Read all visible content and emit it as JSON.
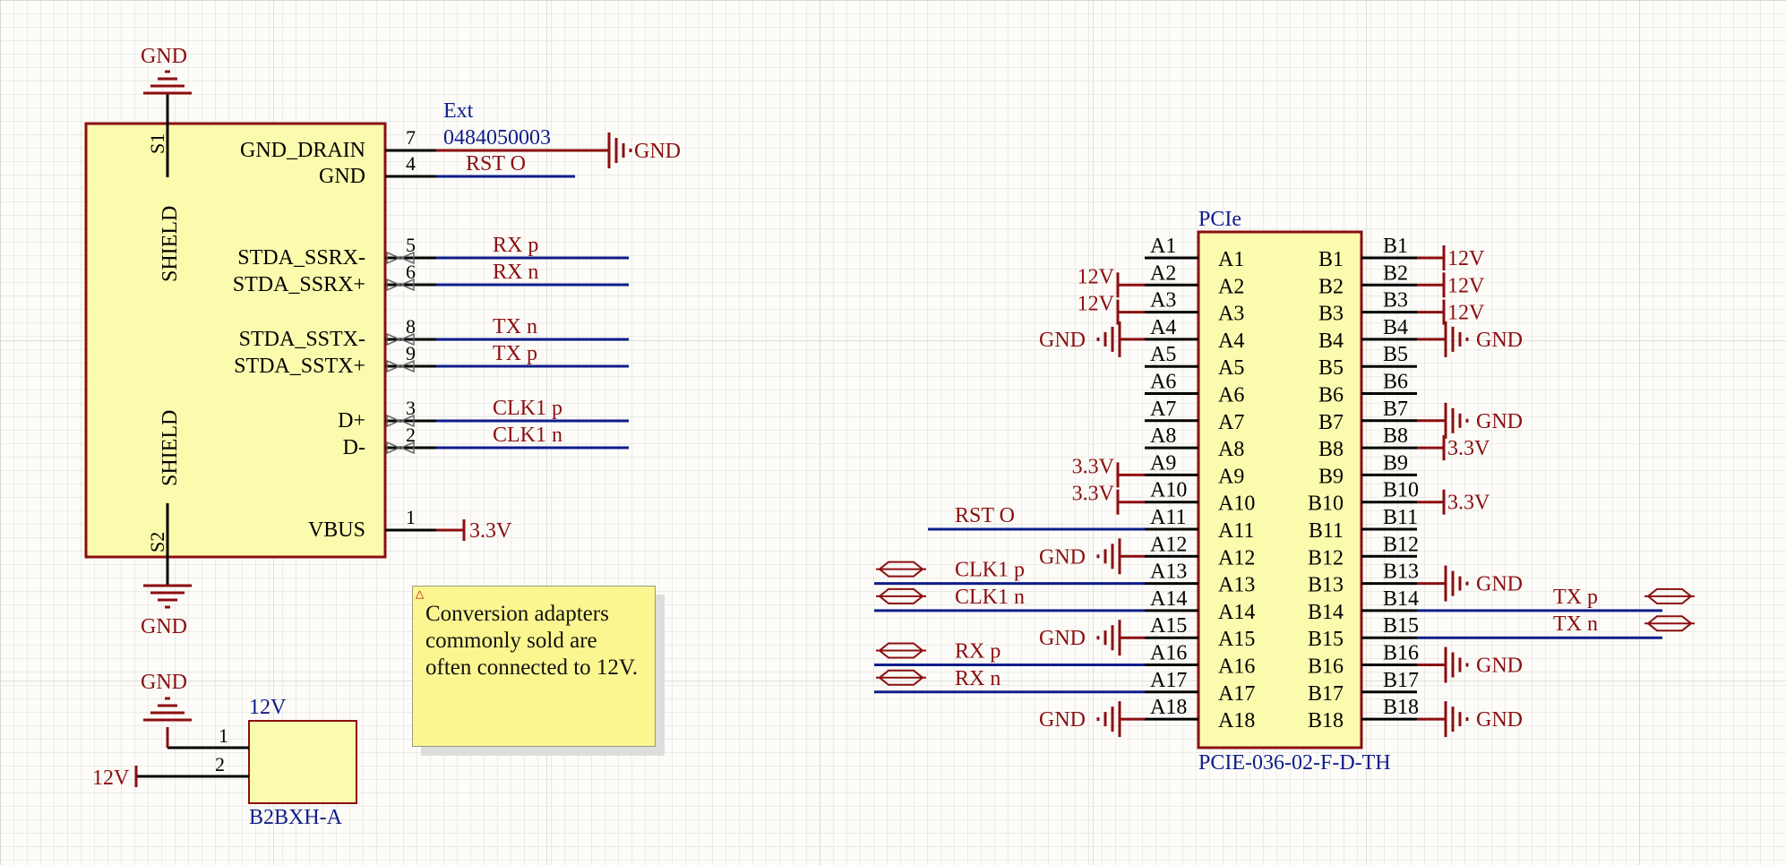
{
  "left_connector": {
    "designator": "Ext",
    "part_number": "0484050003",
    "pins": [
      {
        "num": "7",
        "name": "GND_DRAIN",
        "net": "",
        "power": "GND"
      },
      {
        "num": "4",
        "name": "GND",
        "net": "RST_O",
        "power": ""
      },
      {
        "num": "5",
        "name": "STDA_SSRX-",
        "net": "RX_p",
        "power": ""
      },
      {
        "num": "6",
        "name": "STDA_SSRX+",
        "net": "RX_n",
        "power": ""
      },
      {
        "num": "8",
        "name": "STDA_SSTX-",
        "net": "TX_n",
        "power": ""
      },
      {
        "num": "9",
        "name": "STDA_SSTX+",
        "net": "TX_p",
        "power": ""
      },
      {
        "num": "3",
        "name": "D+",
        "net": "CLK1_p",
        "power": ""
      },
      {
        "num": "2",
        "name": "D-",
        "net": "CLK1_n",
        "power": ""
      },
      {
        "num": "1",
        "name": "VBUS",
        "net": "",
        "power": "3.3V"
      }
    ],
    "shield_top": "S1",
    "shield_bottom": "S2",
    "shield_label": "SHIELD",
    "gnd_top": "GND",
    "gnd_bottom": "GND"
  },
  "power_connector": {
    "designator": "12V",
    "part_number": "B2BXH-A",
    "pins": [
      {
        "num": "1",
        "power": "GND"
      },
      {
        "num": "2",
        "power": "12V"
      }
    ]
  },
  "note": {
    "text": "Conversion adapters commonly sold are often connected to 12V.",
    "icon": "warning-triangle-icon"
  },
  "pcie": {
    "designator": "PCIe",
    "part_number": "PCIE-036-02-F-D-TH",
    "a_pins": [
      {
        "pin": "A1",
        "net": "",
        "power": ""
      },
      {
        "pin": "A2",
        "net": "",
        "power": "12V"
      },
      {
        "pin": "A3",
        "net": "",
        "power": "12V"
      },
      {
        "pin": "A4",
        "net": "",
        "power": "GND"
      },
      {
        "pin": "A5",
        "net": "",
        "power": ""
      },
      {
        "pin": "A6",
        "net": "",
        "power": ""
      },
      {
        "pin": "A7",
        "net": "",
        "power": ""
      },
      {
        "pin": "A8",
        "net": "",
        "power": ""
      },
      {
        "pin": "A9",
        "net": "",
        "power": "3.3V"
      },
      {
        "pin": "A10",
        "net": "",
        "power": "3.3V"
      },
      {
        "pin": "A11",
        "net": "RST_O",
        "power": ""
      },
      {
        "pin": "A12",
        "net": "",
        "power": "GND"
      },
      {
        "pin": "A13",
        "net": "CLK1_p",
        "power": ""
      },
      {
        "pin": "A14",
        "net": "CLK1_n",
        "power": ""
      },
      {
        "pin": "A15",
        "net": "",
        "power": "GND"
      },
      {
        "pin": "A16",
        "net": "RX_p",
        "power": ""
      },
      {
        "pin": "A17",
        "net": "RX_n",
        "power": ""
      },
      {
        "pin": "A18",
        "net": "",
        "power": "GND"
      }
    ],
    "b_pins": [
      {
        "pin": "B1",
        "net": "",
        "power": "12V"
      },
      {
        "pin": "B2",
        "net": "",
        "power": "12V"
      },
      {
        "pin": "B3",
        "net": "",
        "power": "12V"
      },
      {
        "pin": "B4",
        "net": "",
        "power": "GND"
      },
      {
        "pin": "B5",
        "net": "",
        "power": ""
      },
      {
        "pin": "B6",
        "net": "",
        "power": ""
      },
      {
        "pin": "B7",
        "net": "",
        "power": "GND"
      },
      {
        "pin": "B8",
        "net": "",
        "power": "3.3V"
      },
      {
        "pin": "B9",
        "net": "",
        "power": ""
      },
      {
        "pin": "B10",
        "net": "",
        "power": "3.3V"
      },
      {
        "pin": "B11",
        "net": "",
        "power": ""
      },
      {
        "pin": "B12",
        "net": "",
        "power": ""
      },
      {
        "pin": "B13",
        "net": "",
        "power": "GND"
      },
      {
        "pin": "B14",
        "net": "TX_p",
        "power": ""
      },
      {
        "pin": "B15",
        "net": "TX_n",
        "power": ""
      },
      {
        "pin": "B16",
        "net": "",
        "power": "GND"
      },
      {
        "pin": "B17",
        "net": "",
        "power": ""
      },
      {
        "pin": "B18",
        "net": "",
        "power": "GND"
      }
    ]
  },
  "colors": {
    "component_fill": "#fbfbae",
    "component_border": "#8b0e10",
    "wire": "#0e1d8b",
    "power": "#8b0e10",
    "designator": "#0e1d8b",
    "background": "#fdfcf8"
  }
}
